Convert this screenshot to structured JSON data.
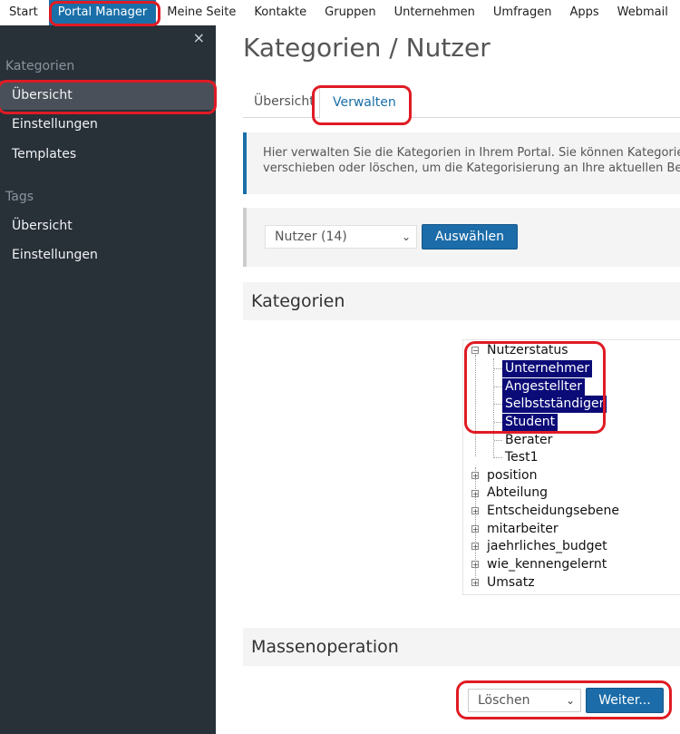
{
  "topnav": {
    "items": [
      "Start",
      "Portal Manager",
      "Meine Seite",
      "Kontakte",
      "Gruppen",
      "Unternehmen",
      "Umfragen",
      "Apps",
      "Webmail"
    ]
  },
  "sidebar": {
    "close_glyph": "×",
    "section1": "Kategorien",
    "section1_items": [
      "Übersicht",
      "Einstellungen",
      "Templates"
    ],
    "section2": "Tags",
    "section2_items": [
      "Übersicht",
      "Einstellungen"
    ]
  },
  "main": {
    "title": "Kategorien / Nutzer",
    "tabs": [
      "Übersicht",
      "Verwalten"
    ],
    "info_line1": "Hier verwalten Sie die Kategorien in Ihrem Portal. Sie können Kategorien",
    "info_line2": "verschieben oder löschen, um die Kategorisierung an Ihre aktuellen Bed",
    "select_value": "Nutzer (14)",
    "select_button": "Auswählen",
    "kategorien_heading": "Kategorien",
    "tree": {
      "root": "Nutzerstatus",
      "children": [
        "Unternehmer",
        "Angestellter",
        "Selbstständiger",
        "Student",
        "Berater",
        "Test1"
      ],
      "collapsed": [
        "position",
        "Abteilung",
        "Entscheidungsebene",
        "mitarbeiter",
        "jaehrliches_budget",
        "wie_kennengelernt",
        "Umsatz"
      ]
    },
    "mass_heading": "Massenoperation",
    "mass_select_value": "Löschen",
    "mass_button": "Weiter..."
  },
  "colors": {
    "accent": "#1a6fa8",
    "sidebar_bg": "#283038",
    "selected_node_bg": "#0b0b78",
    "annotation": "#e01b24"
  }
}
